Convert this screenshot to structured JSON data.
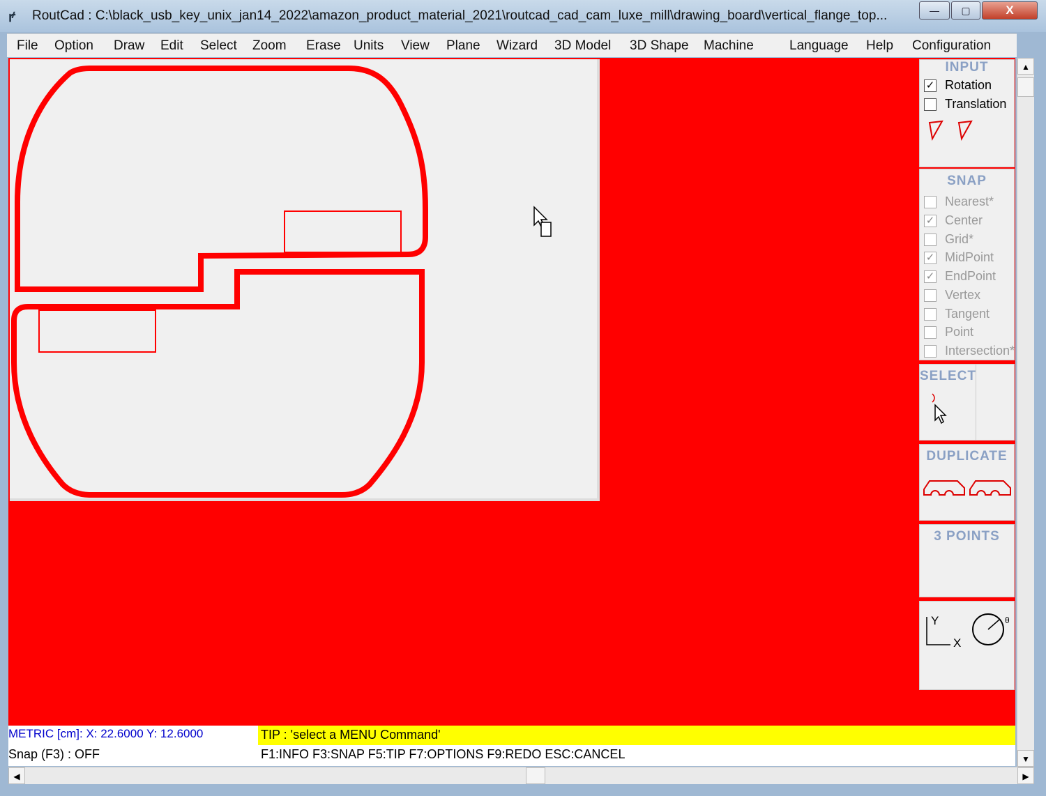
{
  "window": {
    "title": "RoutCad : C:\\black_usb_key_unix_jan14_2022\\amazon_product_material_2021\\routcad_cad_cam_luxe_mill\\drawing_board\\vertical_flange_top...",
    "minimize": "—",
    "maximize": "▢",
    "close": "X"
  },
  "menu": [
    "File",
    "Option",
    "Draw",
    "Edit",
    "Select",
    "Zoom",
    "Erase",
    "Units",
    "View",
    "Plane",
    "Wizard",
    "3D Model",
    "3D Shape",
    "Machine",
    "Language",
    "Help",
    "Configuration"
  ],
  "input": {
    "title": "INPUT",
    "rotation": "Rotation",
    "translation": "Translation",
    "rotation_checked": true,
    "translation_checked": false
  },
  "snap": {
    "title": "SNAP",
    "items": [
      {
        "label": "Nearest*",
        "checked": false
      },
      {
        "label": "Center",
        "checked": true
      },
      {
        "label": "Grid*",
        "checked": false
      },
      {
        "label": "MidPoint",
        "checked": true
      },
      {
        "label": "EndPoint",
        "checked": true
      },
      {
        "label": "Vertex",
        "checked": false
      },
      {
        "label": "Tangent",
        "checked": false
      },
      {
        "label": "Point",
        "checked": false
      },
      {
        "label": "Intersection*",
        "checked": false
      }
    ]
  },
  "select": {
    "title": "SELECT"
  },
  "duplicate": {
    "title": "DUPLICATE"
  },
  "three_points": {
    "title": "3 POINTS"
  },
  "axes": {
    "y": "Y",
    "x": "X",
    "theta": "θ"
  },
  "status": {
    "coords": "METRIC [cm]: X: 22.6000  Y: 12.6000",
    "snap": "Snap (F3) : OFF",
    "tip": "TIP : 'select a MENU Command'",
    "keys": "F1:INFO  F3:SNAP  F5:TIP  F7:OPTIONS  F9:REDO  ESC:CANCEL"
  },
  "colors": {
    "background": "#ff0000",
    "shape": "#ff0000",
    "tip": "#ffff00",
    "coords": "#0000cc"
  }
}
